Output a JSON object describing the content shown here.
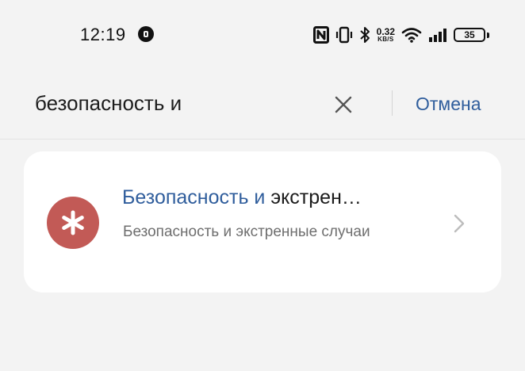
{
  "status_bar": {
    "time": "12:19",
    "network_speed": "0.32",
    "network_speed_unit": "KB/S",
    "battery_level": "35",
    "icons": [
      "nfc-icon",
      "vibrate-icon",
      "bluetooth-icon",
      "wifi-icon",
      "signal-icon",
      "battery-icon"
    ]
  },
  "search": {
    "query": "безопасность и",
    "cancel_label": "Отмена"
  },
  "results": [
    {
      "title_highlight": "Безопасность и",
      "title_rest": " экстрен…",
      "subtitle": "Безопасность и экстренные случаи",
      "icon": "asterisk-icon",
      "icon_color": "#c25a56"
    }
  ],
  "colors": {
    "accent": "#2f5d9c",
    "background": "#f3f3f3",
    "card": "#ffffff"
  }
}
